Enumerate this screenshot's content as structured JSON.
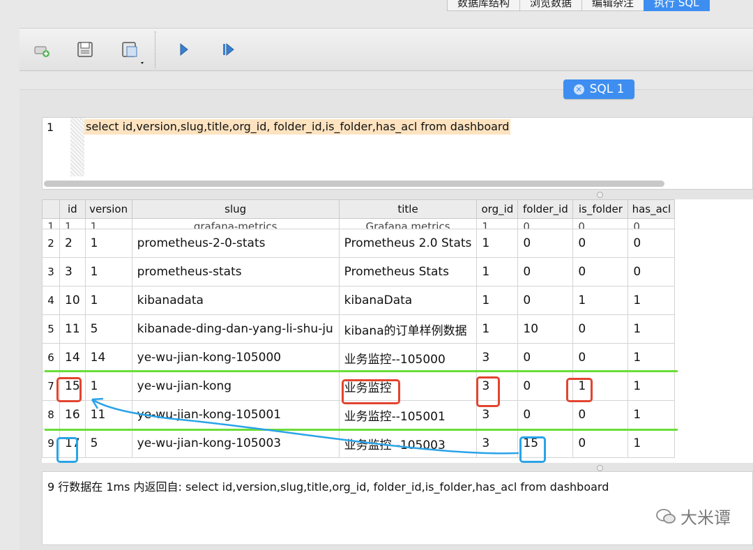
{
  "top_tabs": [
    {
      "label": "数据库结构",
      "active": false
    },
    {
      "label": "浏览数据",
      "active": false
    },
    {
      "label": "编辑杂注",
      "active": false
    },
    {
      "label": "执行 SQL",
      "active": true
    }
  ],
  "toolbar": {
    "icons": [
      "open-tab-icon",
      "save-icon",
      "save-as-icon",
      "execute-icon",
      "execute-line-icon"
    ]
  },
  "sql_tab": {
    "label": "SQL 1"
  },
  "editor": {
    "line_number": "1",
    "sql": "select id,version,slug,title,org_id, folder_id,is_folder,has_acl from dashboard"
  },
  "results": {
    "columns": [
      "id",
      "version",
      "slug",
      "title",
      "org_id",
      "folder_id",
      "is_folder",
      "has_acl"
    ],
    "partial_row": [
      "1",
      "1",
      "1",
      "grafana-metrics",
      "Grafana metrics",
      "1",
      "0",
      "0",
      "0"
    ],
    "rows": [
      [
        "2",
        "2",
        "1",
        "prometheus-2-0-stats",
        "Prometheus 2.0 Stats",
        "1",
        "0",
        "0",
        "0"
      ],
      [
        "3",
        "3",
        "1",
        "prometheus-stats",
        "Prometheus Stats",
        "1",
        "0",
        "0",
        "0"
      ],
      [
        "4",
        "10",
        "1",
        "kibanadata",
        "kibanaData",
        "1",
        "0",
        "1",
        "1"
      ],
      [
        "5",
        "11",
        "5",
        "kibanade-ding-dan-yang-li-shu-ju",
        "kibana的订单样例数据",
        "1",
        "10",
        "0",
        "1"
      ],
      [
        "6",
        "14",
        "14",
        "ye-wu-jian-kong-105000",
        "业务监控--105000",
        "3",
        "0",
        "0",
        "1"
      ],
      [
        "7",
        "15",
        "1",
        "ye-wu-jian-kong",
        "业务监控",
        "3",
        "0",
        "1",
        "1"
      ],
      [
        "8",
        "16",
        "11",
        "ye-wu-jian-kong-105001",
        "业务监控--105001",
        "3",
        "0",
        "0",
        "1"
      ],
      [
        "9",
        "17",
        "5",
        "ye-wu-jian-kong-105003",
        "业务监控--105003",
        "3",
        "15",
        "0",
        "1"
      ]
    ]
  },
  "status": {
    "text": "9 行数据在 1ms 内返回自: select id,version,slug,title,org_id, folder_id,is_folder,has_acl from dashboard"
  },
  "watermark": {
    "text": "大米谭"
  },
  "colors": {
    "accent": "#3d8ef0",
    "highlight_red": "#e2442f",
    "highlight_blue": "#2aa3e8",
    "highlight_green": "#6bdd37",
    "sql_highlight": "#fde3c0"
  }
}
